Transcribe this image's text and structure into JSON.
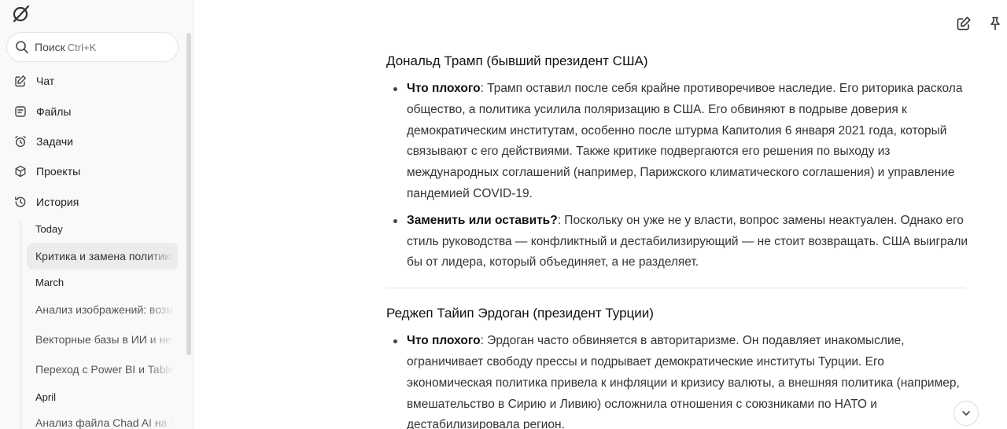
{
  "sidebar": {
    "search": {
      "label": "Поиск",
      "hint": "Ctrl+K"
    },
    "nav": [
      {
        "label": "Чат",
        "icon": "edit-icon"
      },
      {
        "label": "Файлы",
        "icon": "files-icon"
      },
      {
        "label": "Задачи",
        "icon": "alarm-clock-icon"
      },
      {
        "label": "Проекты",
        "icon": "cube-icon"
      },
      {
        "label": "История",
        "icon": "history-icon"
      }
    ],
    "history": {
      "groups": [
        "Today",
        "March",
        "April"
      ],
      "items": [
        "Критика и замена политиков",
        "Анализ изображений: возможности",
        "Векторные базы в ИИ и не только",
        "Переход с Power BI и Tableau",
        "Анализ файла Chad AI на Tilda"
      ]
    }
  },
  "content": {
    "section1": {
      "title": "Дональд Трамп (бывший президент США)",
      "bullets": [
        {
          "label": "Что плохого",
          "text": ": Трамп оставил после себя крайне противоречивое наследие. Его риторика раскола общество, а политика усилила поляризацию в США. Его обвиняют в подрыве доверия к демократическим институтам, особенно после штурма Капитолия 6 января 2021 года, который связывают с его действиями. Также критике подвергаются его решения по выходу из международных соглашений (например, Парижского климатического соглашения) и управление пандемией COVID-19."
        },
        {
          "label": "Заменить или оставить?",
          "text": ": Поскольку он уже не у власти, вопрос замены неактуален. Однако его стиль руководства — конфликтный и дестабилизирующий — не стоит возвращать. США выиграли бы от лидера, который объединяет, а не разделяет."
        }
      ]
    },
    "section2": {
      "title": "Реджеп Тайип Эрдоган (президент Турции)",
      "bullets": [
        {
          "label": "Что плохого",
          "text": ": Эрдоган часто обвиняется в авторитаризме. Он подавляет инакомыслие, ограничивает свободу прессы и подрывает демократические институты Турции. Его экономическая политика привела к инфляции и кризису валюты, а внешняя политика (например, вмешательство в Сирию и Ливию) осложнила отношения с союзниками по НАТО и дестабилизировала регион."
        }
      ]
    }
  }
}
